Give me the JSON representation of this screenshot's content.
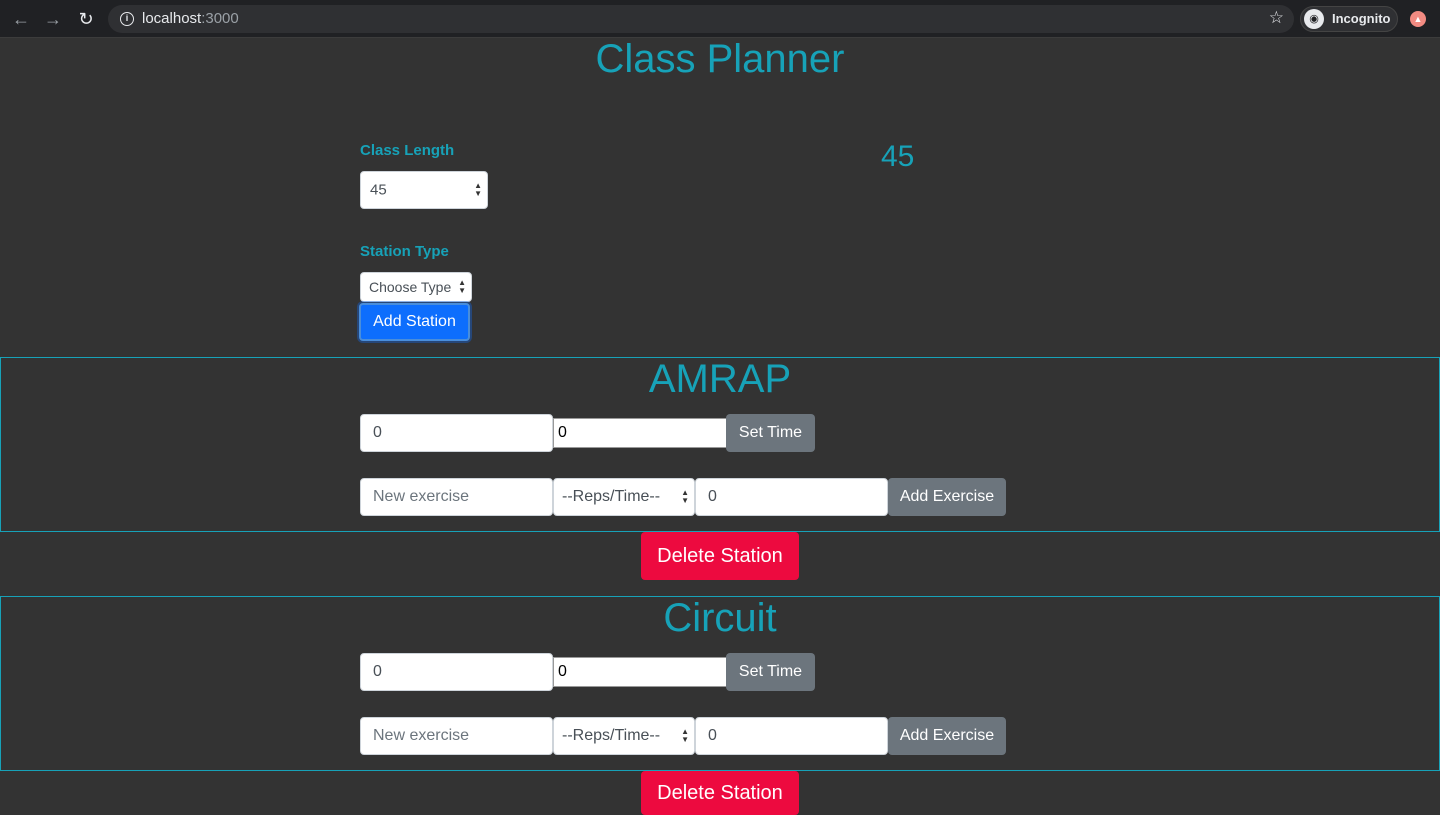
{
  "browser": {
    "url_host": "localhost",
    "url_port": ":3000",
    "profile_label": "Incognito"
  },
  "page": {
    "title": "Class Planner",
    "class_length_label": "Class Length",
    "class_length_value": "45",
    "class_length_display": "45",
    "station_type_label": "Station Type",
    "station_type_value": "Choose Type",
    "add_station_label": "Add Station"
  },
  "stations": [
    {
      "title": "AMRAP",
      "time_value_1": "0",
      "time_value_2": "0",
      "set_time_label": "Set Time",
      "exercise_placeholder": "New exercise",
      "reps_select_value": "--Reps/Time--",
      "amount_value": "0",
      "add_exercise_label": "Add Exercise",
      "delete_label": "Delete Station"
    },
    {
      "title": "Circuit",
      "time_value_1": "0",
      "time_value_2": "0",
      "set_time_label": "Set Time",
      "exercise_placeholder": "New exercise",
      "reps_select_value": "--Reps/Time--",
      "amount_value": "0",
      "add_exercise_label": "Add Exercise",
      "delete_label": "Delete Station"
    }
  ],
  "colors": {
    "accent": "#17a2b8",
    "background": "#333333",
    "primary": "#0d6efd",
    "secondary": "#6c757d",
    "danger": "#ed0a3f"
  },
  "icons": {
    "back": "arrow-left-icon",
    "forward": "arrow-right-icon",
    "reload": "reload-icon",
    "info": "info-icon",
    "bookmark": "star-icon",
    "incognito": "incognito-icon",
    "extension": "extension-icon"
  }
}
